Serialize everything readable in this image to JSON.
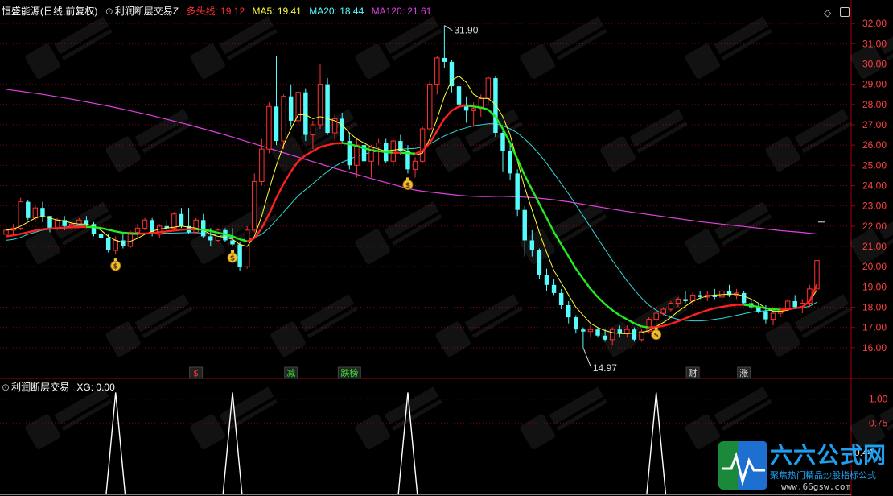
{
  "main_header": {
    "stock_name": "恒盛能源",
    "period": "(日线,前复权)",
    "indicator_name": "利润断层交易Z",
    "dtx_label": "多头线: 19.12",
    "ma5_label": "MA5: 19.41",
    "ma20_label": "MA20: 18.44",
    "ma120_label": "MA120: 21.61"
  },
  "sub_header": {
    "indicator_name": "利润断层交易",
    "xg_label": "XG: 0.00"
  },
  "annotations": {
    "high": "31.90",
    "low": "14.97"
  },
  "event_tags": [
    {
      "text": "$",
      "color": "#ff3333"
    },
    {
      "text": "减",
      "color": "#33dd33"
    },
    {
      "text": "跌榜",
      "color": "#33dd33"
    },
    {
      "text": "财",
      "color": "#dddddd"
    },
    {
      "text": "涨",
      "color": "#dddddd"
    }
  ],
  "logo": {
    "title": "六六公式网",
    "slogan": "聚焦热门精品炒股指标公式",
    "url": "www.66gsw.com"
  },
  "colors": {
    "up": "#ff3232",
    "down": "#54fcfc",
    "ma5": "#ffff3a",
    "ma20": "#30d8d8",
    "ma120": "#e040e0",
    "grid": "#8b0000",
    "axis_text": "#ff4040"
  },
  "chart_data": [
    {
      "type": "candlestick",
      "title": "恒盛能源 (日线,前复权)",
      "ylim": [
        15.2,
        32.6
      ],
      "y_ticks": [
        16.0,
        17.0,
        18.0,
        19.0,
        20.0,
        21.0,
        22.0,
        23.0,
        24.0,
        25.0,
        26.0,
        27.0,
        28.0,
        29.0,
        30.0,
        31.0,
        32.0
      ],
      "ohlc": [
        [
          21.6,
          21.9,
          21.4,
          21.8
        ],
        [
          21.8,
          22.1,
          21.6,
          21.9
        ],
        [
          21.9,
          23.4,
          21.8,
          23.2
        ],
        [
          23.2,
          23.3,
          22.3,
          22.4
        ],
        [
          22.4,
          23.0,
          22.2,
          22.9
        ],
        [
          22.9,
          23.2,
          22.2,
          22.5
        ],
        [
          22.5,
          22.5,
          21.7,
          21.9
        ],
        [
          21.9,
          22.4,
          21.8,
          22.3
        ],
        [
          22.3,
          22.5,
          21.8,
          22.0
        ],
        [
          22.0,
          22.2,
          21.8,
          22.1
        ],
        [
          22.1,
          22.4,
          21.9,
          22.3
        ],
        [
          22.3,
          22.5,
          21.9,
          22.1
        ],
        [
          22.1,
          22.2,
          21.5,
          21.6
        ],
        [
          21.6,
          21.7,
          21.3,
          21.4
        ],
        [
          21.4,
          21.6,
          20.7,
          20.8
        ],
        [
          20.8,
          21.5,
          20.6,
          21.3
        ],
        [
          21.3,
          21.6,
          20.9,
          21.0
        ],
        [
          21.0,
          21.8,
          20.9,
          21.7
        ],
        [
          21.7,
          22.1,
          21.4,
          21.9
        ],
        [
          21.9,
          22.4,
          21.8,
          22.3
        ],
        [
          22.3,
          22.4,
          21.5,
          21.6
        ],
        [
          21.6,
          22.1,
          21.4,
          22.0
        ],
        [
          22.0,
          22.3,
          21.8,
          21.9
        ],
        [
          21.9,
          22.7,
          21.8,
          22.6
        ],
        [
          22.6,
          22.9,
          21.9,
          22.0
        ],
        [
          22.0,
          22.9,
          21.6,
          21.7
        ],
        [
          21.7,
          22.4,
          21.6,
          22.3
        ],
        [
          22.3,
          22.6,
          21.4,
          21.5
        ],
        [
          21.5,
          21.9,
          21.0,
          21.3
        ],
        [
          21.3,
          21.9,
          21.2,
          21.8
        ],
        [
          21.8,
          21.9,
          21.2,
          21.3
        ],
        [
          21.3,
          21.9,
          21.0,
          21.1
        ],
        [
          21.1,
          21.2,
          19.8,
          20.0
        ],
        [
          20.0,
          22.0,
          19.9,
          21.8
        ],
        [
          21.8,
          24.6,
          21.7,
          24.2
        ],
        [
          24.2,
          26.3,
          24.0,
          25.8
        ],
        [
          25.8,
          28.1,
          25.6,
          27.9
        ],
        [
          27.9,
          30.4,
          26.0,
          26.2
        ],
        [
          26.2,
          28.5,
          25.8,
          28.4
        ],
        [
          28.4,
          29.0,
          26.9,
          27.2
        ],
        [
          27.2,
          28.6,
          27.0,
          28.6
        ],
        [
          28.6,
          28.8,
          26.2,
          26.5
        ],
        [
          26.5,
          27.2,
          25.8,
          27.0
        ],
        [
          27.0,
          30.0,
          26.8,
          29.0
        ],
        [
          29.0,
          29.3,
          26.5,
          26.6
        ],
        [
          26.6,
          27.5,
          26.2,
          27.3
        ],
        [
          27.3,
          27.6,
          26.1,
          26.2
        ],
        [
          26.2,
          26.6,
          24.8,
          25.0
        ],
        [
          25.0,
          26.3,
          24.4,
          26.0
        ],
        [
          26.0,
          26.4,
          24.9,
          25.2
        ],
        [
          25.2,
          26.0,
          24.4,
          25.9
        ],
        [
          25.9,
          26.3,
          25.0,
          26.1
        ],
        [
          26.1,
          26.3,
          25.1,
          25.2
        ],
        [
          25.2,
          26.3,
          24.9,
          26.2
        ],
        [
          26.2,
          26.5,
          25.5,
          25.7
        ],
        [
          25.7,
          26.0,
          24.6,
          24.8
        ],
        [
          24.8,
          25.4,
          24.4,
          25.2
        ],
        [
          25.2,
          26.9,
          25.1,
          26.8
        ],
        [
          26.8,
          29.2,
          26.7,
          29.0
        ],
        [
          29.0,
          30.4,
          28.5,
          30.3
        ],
        [
          30.3,
          31.9,
          29.8,
          30.1
        ],
        [
          30.1,
          30.2,
          28.6,
          28.9
        ],
        [
          28.9,
          29.2,
          27.6,
          28.0
        ],
        [
          28.0,
          28.4,
          27.1,
          27.7
        ],
        [
          27.7,
          28.1,
          26.9,
          27.8
        ],
        [
          27.8,
          28.5,
          27.4,
          28.3
        ],
        [
          28.3,
          29.4,
          28.0,
          29.3
        ],
        [
          29.3,
          29.4,
          26.4,
          26.6
        ],
        [
          26.6,
          26.7,
          24.7,
          25.7
        ],
        [
          25.7,
          26.1,
          24.3,
          24.6
        ],
        [
          24.6,
          24.8,
          22.5,
          22.8
        ],
        [
          22.8,
          23.0,
          20.5,
          21.3
        ],
        [
          21.3,
          21.8,
          20.5,
          20.8
        ],
        [
          20.8,
          20.9,
          19.4,
          19.6
        ],
        [
          19.6,
          19.9,
          18.8,
          19.1
        ],
        [
          19.1,
          19.4,
          18.6,
          18.7
        ],
        [
          18.7,
          18.9,
          17.9,
          18.1
        ],
        [
          18.1,
          18.3,
          17.2,
          17.5
        ],
        [
          17.5,
          17.6,
          16.7,
          16.9
        ],
        [
          16.9,
          17.0,
          16.0,
          16.8
        ],
        [
          16.8,
          17.1,
          16.5,
          16.9
        ],
        [
          16.9,
          17.0,
          16.5,
          16.6
        ],
        [
          16.6,
          16.9,
          16.3,
          16.4
        ],
        [
          16.4,
          17.0,
          16.1,
          16.9
        ],
        [
          16.9,
          17.1,
          16.5,
          16.7
        ],
        [
          16.7,
          17.1,
          16.5,
          16.9
        ],
        [
          16.9,
          17.0,
          16.3,
          16.4
        ],
        [
          16.4,
          16.9,
          16.3,
          16.8
        ],
        [
          16.8,
          17.5,
          16.7,
          17.4
        ],
        [
          17.4,
          17.9,
          17.2,
          17.7
        ],
        [
          17.7,
          18.0,
          17.6,
          17.9
        ],
        [
          17.9,
          18.3,
          17.8,
          18.2
        ],
        [
          18.2,
          18.5,
          18.0,
          18.4
        ],
        [
          18.4,
          18.8,
          18.2,
          18.3
        ],
        [
          18.3,
          18.7,
          18.1,
          18.6
        ],
        [
          18.6,
          18.8,
          18.4,
          18.5
        ],
        [
          18.5,
          18.8,
          18.3,
          18.6
        ],
        [
          18.6,
          18.9,
          18.4,
          18.5
        ],
        [
          18.5,
          18.9,
          18.3,
          18.8
        ],
        [
          18.8,
          19.1,
          18.5,
          18.6
        ],
        [
          18.6,
          18.9,
          18.4,
          18.7
        ],
        [
          18.7,
          18.8,
          18.1,
          18.2
        ],
        [
          18.2,
          18.4,
          17.9,
          18.0
        ],
        [
          18.0,
          18.2,
          17.7,
          17.8
        ],
        [
          17.8,
          18.1,
          17.2,
          17.4
        ],
        [
          17.4,
          17.8,
          17.1,
          17.7
        ],
        [
          17.7,
          18.0,
          17.5,
          17.9
        ],
        [
          17.9,
          18.4,
          17.8,
          18.3
        ],
        [
          18.3,
          18.6,
          17.9,
          18.0
        ],
        [
          18.0,
          18.4,
          17.7,
          18.2
        ],
        [
          18.2,
          19.1,
          18.0,
          18.9
        ],
        [
          18.9,
          20.4,
          18.7,
          20.3
        ]
      ],
      "ma5": [
        21.8,
        21.85,
        22.0,
        22.2,
        22.4,
        22.5,
        22.4,
        22.3,
        22.25,
        22.15,
        22.1,
        22.1,
        22.0,
        21.8,
        21.5,
        21.3,
        21.2,
        21.25,
        21.4,
        21.6,
        21.75,
        21.85,
        21.9,
        21.95,
        22.0,
        21.95,
        21.9,
        21.8,
        21.6,
        21.5,
        21.45,
        21.35,
        21.1,
        21.0,
        21.5,
        22.5,
        23.8,
        25.0,
        26.0,
        26.8,
        27.5,
        27.5,
        27.3,
        27.4,
        27.3,
        27.2,
        27.0,
        26.6,
        26.3,
        26.1,
        25.9,
        25.8,
        25.7,
        25.75,
        25.8,
        25.7,
        25.5,
        25.6,
        26.3,
        27.3,
        28.4,
        29.2,
        29.4,
        29.1,
        28.5,
        28.3,
        28.3,
        28.0,
        27.4,
        26.5,
        25.2,
        23.9,
        22.8,
        21.7,
        20.7,
        19.8,
        19.2,
        18.6,
        18.0,
        17.6,
        17.2,
        17.0,
        16.85,
        16.75,
        16.7,
        16.7,
        16.72,
        16.75,
        16.85,
        17.05,
        17.25,
        17.5,
        17.8,
        18.05,
        18.3,
        18.45,
        18.55,
        18.6,
        18.62,
        18.65,
        18.65,
        18.55,
        18.4,
        18.2,
        17.95,
        17.8,
        17.8,
        17.85,
        17.95,
        18.05,
        18.3,
        18.85
      ],
      "ma20": [
        21.3,
        21.35,
        21.45,
        21.6,
        21.7,
        21.8,
        21.85,
        21.9,
        21.95,
        22.0,
        22.0,
        22.0,
        21.95,
        21.9,
        21.8,
        21.75,
        21.7,
        21.68,
        21.66,
        21.65,
        21.65,
        21.65,
        21.65,
        21.66,
        21.67,
        21.68,
        21.68,
        21.65,
        21.6,
        21.55,
        21.5,
        21.45,
        21.35,
        21.35,
        21.45,
        21.6,
        21.9,
        22.3,
        22.7,
        23.1,
        23.5,
        23.8,
        24.1,
        24.4,
        24.7,
        24.95,
        25.15,
        25.3,
        25.45,
        25.55,
        25.65,
        25.7,
        25.72,
        25.75,
        25.8,
        25.82,
        25.84,
        25.9,
        26.05,
        26.25,
        26.45,
        26.6,
        26.75,
        26.85,
        26.95,
        27.0,
        27.05,
        27.05,
        26.95,
        26.8,
        26.6,
        26.3,
        25.95,
        25.55,
        25.1,
        24.6,
        24.1,
        23.6,
        23.05,
        22.5,
        21.95,
        21.4,
        20.85,
        20.3,
        19.8,
        19.3,
        18.85,
        18.45,
        18.1,
        17.85,
        17.65,
        17.5,
        17.4,
        17.35,
        17.32,
        17.32,
        17.35,
        17.4,
        17.45,
        17.52,
        17.6,
        17.68,
        17.75,
        17.8,
        17.83,
        17.85,
        17.87,
        17.9,
        17.93,
        17.97,
        18.05,
        18.25
      ],
      "ma120": [
        28.75,
        28.7,
        28.65,
        28.6,
        28.55,
        28.5,
        28.44,
        28.38,
        28.32,
        28.26,
        28.2,
        28.13,
        28.06,
        27.99,
        27.92,
        27.85,
        27.77,
        27.69,
        27.61,
        27.53,
        27.45,
        27.36,
        27.27,
        27.18,
        27.09,
        27.0,
        26.9,
        26.8,
        26.7,
        26.6,
        26.5,
        26.39,
        26.28,
        26.17,
        26.06,
        25.95,
        25.84,
        25.73,
        25.62,
        25.51,
        25.4,
        25.29,
        25.18,
        25.07,
        24.96,
        24.85,
        24.75,
        24.65,
        24.55,
        24.45,
        24.35,
        24.25,
        24.15,
        24.05,
        23.95,
        23.85,
        23.78,
        23.72,
        23.68,
        23.64,
        23.6,
        23.56,
        23.52,
        23.49,
        23.47,
        23.46,
        23.46,
        23.47,
        23.47,
        23.46,
        23.45,
        23.43,
        23.41,
        23.38,
        23.34,
        23.3,
        23.25,
        23.2,
        23.14,
        23.08,
        23.02,
        22.96,
        22.9,
        22.84,
        22.78,
        22.72,
        22.67,
        22.62,
        22.57,
        22.52,
        22.47,
        22.42,
        22.37,
        22.32,
        22.27,
        22.22,
        22.18,
        22.14,
        22.1,
        22.06,
        22.02,
        21.98,
        21.94,
        21.9,
        21.86,
        21.82,
        21.78,
        21.75,
        21.72,
        21.69,
        21.65,
        21.61
      ],
      "dtx": [
        21.5,
        21.55,
        21.62,
        21.7,
        21.78,
        21.84,
        21.88,
        21.9,
        21.92,
        21.94,
        21.95,
        21.96,
        21.95,
        21.9,
        21.82,
        21.74,
        21.67,
        21.63,
        21.62,
        21.64,
        21.66,
        21.7,
        21.74,
        21.78,
        21.82,
        21.84,
        21.84,
        21.82,
        21.76,
        21.68,
        21.6,
        21.5,
        21.35,
        21.25,
        21.4,
        21.9,
        22.6,
        23.4,
        24.1,
        24.7,
        25.2,
        25.5,
        25.7,
        25.9,
        26.0,
        26.08,
        26.1,
        26.05,
        25.95,
        25.85,
        25.75,
        25.7,
        25.65,
        25.62,
        25.62,
        25.6,
        25.58,
        25.7,
        26.1,
        26.7,
        27.3,
        27.7,
        27.9,
        27.95,
        27.9,
        27.85,
        27.75,
        27.4,
        26.8,
        26.1,
        25.3,
        24.5,
        23.8,
        23.1,
        22.4,
        21.7,
        21.1,
        20.5,
        19.9,
        19.4,
        18.9,
        18.5,
        18.15,
        17.85,
        17.6,
        17.4,
        17.2,
        17.05,
        17.0,
        17.02,
        17.08,
        17.18,
        17.3,
        17.45,
        17.6,
        17.73,
        17.85,
        17.95,
        18.02,
        18.08,
        18.12,
        18.12,
        18.08,
        18.02,
        17.95,
        17.9,
        17.88,
        17.9,
        17.95,
        18.02,
        18.3,
        19.12
      ],
      "buy_signal_indices": [
        15,
        31,
        55,
        89
      ]
    },
    {
      "type": "line",
      "title": "利润断层交易",
      "ylim": [
        0,
        1.15
      ],
      "y_ticks": [
        1.0,
        0.75
      ],
      "current_value_label": "0.44",
      "xg": [
        0,
        0,
        0,
        0,
        0,
        0,
        0,
        0,
        0,
        0,
        0,
        0,
        0,
        0,
        0,
        0,
        0,
        0,
        0,
        0,
        0,
        0,
        0,
        0,
        0,
        0,
        0,
        0,
        0,
        0,
        0,
        0,
        0,
        0,
        0,
        0,
        0,
        0,
        0,
        0,
        0,
        0,
        0,
        0,
        0,
        0,
        0,
        0,
        0,
        0,
        0,
        0,
        0,
        0,
        0,
        0,
        0,
        0,
        0,
        0,
        0,
        0,
        0,
        0,
        0,
        0,
        0,
        0,
        0,
        0,
        0,
        0,
        0,
        0,
        0,
        0,
        0,
        0,
        0,
        0,
        0,
        0,
        0,
        0,
        0,
        0,
        0,
        0,
        0,
        0,
        0,
        0,
        0,
        0,
        0,
        0,
        0,
        0,
        0,
        0,
        0,
        0,
        0,
        0,
        0,
        0,
        0,
        0,
        0,
        0,
        0,
        0
      ],
      "xg_spike_indices": [
        15,
        31,
        55,
        89
      ]
    }
  ]
}
